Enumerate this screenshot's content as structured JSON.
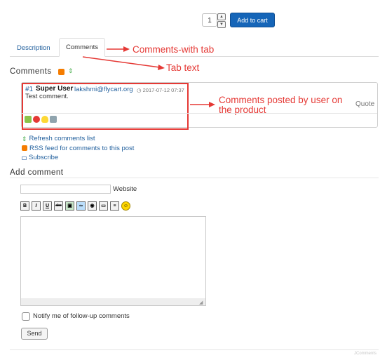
{
  "cart": {
    "quantity": "1",
    "add_label": "Add to cart"
  },
  "tabs": [
    {
      "label": "Description"
    },
    {
      "label": "Comments"
    }
  ],
  "annotations": {
    "tab": "Comments-with tab",
    "tab_text": "Tab text",
    "comments": "Comments posted by user on the product"
  },
  "comments_section": {
    "heading": "Comments",
    "comment": {
      "number": "#1",
      "user": "Super User",
      "email": "lakshmi@flycart.org",
      "date": "2017-07-12 07:37",
      "text": "Test comment.",
      "quote_label": "Quote"
    },
    "links": {
      "refresh": "Refresh comments list",
      "rss": "RSS feed for comments to this post",
      "subscribe": "Subscribe"
    }
  },
  "add_comment": {
    "heading": "Add comment",
    "website_label": "Website",
    "toolbar": [
      "B",
      "I",
      "U",
      "abc"
    ],
    "notify_label": "Notify me of follow-up comments",
    "send_label": "Send"
  },
  "footer": {
    "brand": "JComments"
  },
  "colors": {
    "accent": "#1565b8",
    "annotation": "#e53935",
    "link": "#1f5e9c"
  }
}
